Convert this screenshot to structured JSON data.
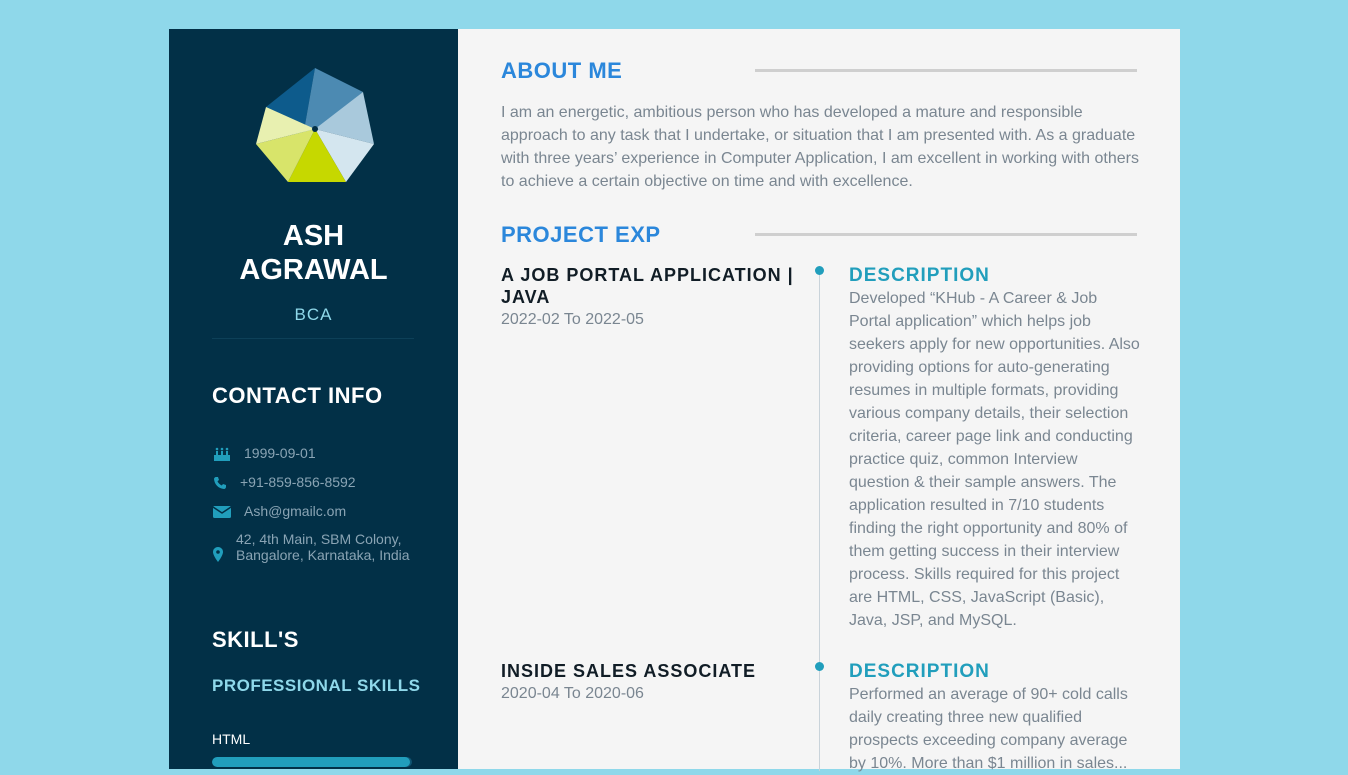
{
  "profile": {
    "first_name": "ASH",
    "last_name": "AGRAWAL",
    "degree": "BCA"
  },
  "contact": {
    "heading": "CONTACT INFO",
    "dob": "1999-09-01",
    "phone": "+91-859-856-8592",
    "email": "Ash@gmailc.om",
    "address": "42, 4th Main, SBM Colony, Bangalore, Karnataka, India"
  },
  "skills": {
    "heading": "SKILL'S",
    "subheading": "PROFESSIONAL SKILLS",
    "items": [
      {
        "label": "HTML",
        "level": 0.99
      }
    ]
  },
  "about": {
    "title": "ABOUT ME",
    "text": "I am an energetic, ambitious person who has developed a mature and responsible approach to any task that I undertake, or situation that I am presented with. As a graduate with three years’ experience in Computer Application, I am excellent in working with others to achieve a certain objective on time and with excellence."
  },
  "projects": {
    "title": "PROJECT EXP",
    "items": [
      {
        "title": "A JOB PORTAL APPLICATION | JAVA",
        "dates": "2022-02 To 2022-05",
        "desc_heading": "DESCRIPTION",
        "description": "Developed “KHub - A Career & Job Portal application” which helps job seekers apply for new opportunities. Also providing options for auto-generating resumes in multiple formats, providing various company details, their selection criteria, career page link and conducting practice quiz, common Interview question & their sample answers. The application resulted in 7/10 students finding the right opportunity and 80% of them getting success in their interview process. Skills required for this project are HTML, CSS, JavaScript (Basic), Java, JSP, and MySQL."
      },
      {
        "title": "INSIDE SALES ASSOCIATE",
        "dates": "2020-04 To 2020-06",
        "desc_heading": "DESCRIPTION",
        "description": "Performed an average of 90+ cold calls daily creating three new qualified prospects exceeding company average by 10%. More than $1 million in sales..."
      }
    ]
  },
  "colors": {
    "page_bg": "#8fd8ea",
    "sidebar_bg": "#023047",
    "accent": "#219ebc",
    "title_blue": "#2b87db"
  },
  "icons": [
    "logo-heptagon-icon",
    "birthday-cake-icon",
    "phone-icon",
    "envelope-icon",
    "map-pin-icon"
  ]
}
